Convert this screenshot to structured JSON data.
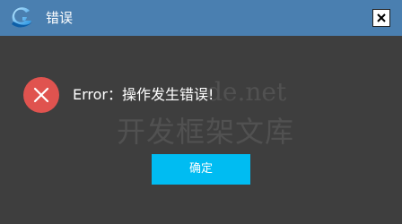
{
  "window": {
    "title": "错误",
    "logo_icon": "app-logo-icon",
    "close_icon": "close-icon",
    "title_bar_color": "#4a7fb0"
  },
  "content": {
    "error_icon": "error-x-icon",
    "error_icon_color": "#e0534f",
    "message": "Error：操作发生错误!",
    "watermark_line1": "de.net",
    "watermark_line2": "开发框架文库"
  },
  "actions": {
    "ok_label": "确定",
    "ok_color": "#00bcf2"
  }
}
